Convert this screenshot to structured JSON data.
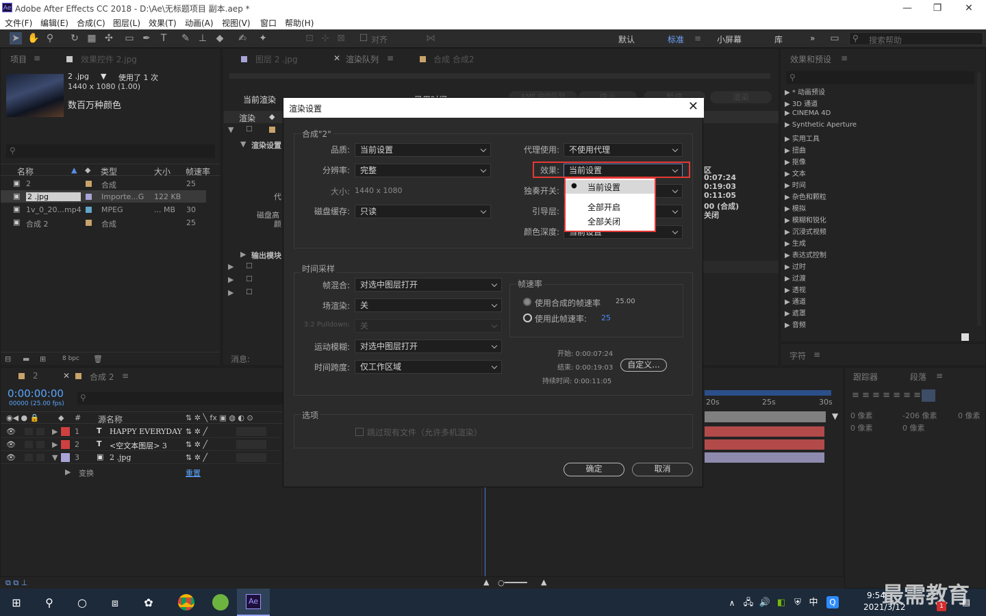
{
  "window": {
    "title": "Adobe After Effects CC 2018 - D:\\Ae\\无标题项目 副本.aep *",
    "logo": "Ae"
  },
  "menu": [
    "文件(F)",
    "编辑(E)",
    "合成(C)",
    "图层(L)",
    "效果(T)",
    "动画(A)",
    "视图(V)",
    "窗口",
    "帮助(H)"
  ],
  "toolbar": {
    "align_label": "对齐",
    "workspaces": [
      "默认",
      "标准",
      "小屏幕",
      "库"
    ],
    "active_workspace": "标准",
    "search_placeholder": "搜索帮助"
  },
  "project_panel": {
    "tab_project": "项目",
    "tab_effect_controls": "效果控件 2.jpg",
    "file_name": "2 .jpg",
    "used": "使用了 1 次",
    "dimensions": "1440 x 1080 (1.00)",
    "colors": "数百万种颜色",
    "columns": [
      "名称",
      "类型",
      "大小",
      "帧速率"
    ],
    "items": [
      {
        "name": "2",
        "type": "合成",
        "size": "",
        "fps": "25",
        "color": "#c8a36a"
      },
      {
        "name": "2 .jpg",
        "type": "Importe...G",
        "size": "122 KB",
        "fps": "",
        "color": "#a9a4d6"
      },
      {
        "name": "1v_0_20...mp4",
        "type": "MPEG",
        "size": "... MB",
        "fps": "30",
        "color": "#62a6c9"
      },
      {
        "name": "合成 2",
        "type": "合成",
        "size": "",
        "fps": "25",
        "color": "#c8a36a"
      }
    ],
    "bpc": "8 bpc"
  },
  "center_tabs": {
    "layer": "图层 2 .jpg",
    "render_queue": "渲染队列",
    "comp": "合成 合成2"
  },
  "render_queue": {
    "current_render": "当前渲染",
    "elapsed": "已用时间",
    "render_col": "渲染",
    "render_settings": "渲染设置",
    "output_module": "输出模块",
    "proxy": "代",
    "disk": "磁盘高",
    "color": "颜",
    "messages": "消息:",
    "right_info": [
      "区",
      "0:07:24",
      "0:19:03",
      "0:11:05",
      "00 (合成)",
      "关闭"
    ],
    "buttons": [
      "AME 中的队列",
      "停止",
      "暂停",
      "渲染"
    ]
  },
  "timeline": {
    "tab_2": "2",
    "tab_comp": "合成 2",
    "timecode": "0:00:00:00",
    "frames": "00000 (25.00 fps)",
    "source_name": "源名称",
    "transform": "变换",
    "reset": "重置",
    "layers": [
      {
        "num": "1",
        "type": "T",
        "name": "HAPPY EVERYDAY",
        "color": "#d04040"
      },
      {
        "num": "2",
        "type": "T",
        "name": "<空文本图层> 3",
        "color": "#d04040"
      },
      {
        "num": "3",
        "type": "img",
        "name": "2 .jpg",
        "color": "#a9a4d6"
      }
    ],
    "ruler": [
      "20s",
      "25s",
      "30s"
    ]
  },
  "effects_panel": {
    "title": "效果和预设",
    "items": [
      "* 动画预设",
      "3D 通道",
      "CINEMA 4D",
      "Synthetic Aperture",
      "实用工具",
      "扭曲",
      "抠像",
      "文本",
      "时间",
      "杂色和颗粒",
      "模拟",
      "模糊和锐化",
      "沉浸式视频",
      "生成",
      "表达式控制",
      "过时",
      "过渡",
      "透视",
      "通道",
      "遮罩",
      "音频"
    ],
    "char_title": "字符"
  },
  "right_lower": {
    "tracker": "跟踪器",
    "paragraph": "段落",
    "px1": "0 像素",
    "px2": "-206 像素",
    "px3": "0 像素",
    "px4": "0 像素",
    "px5": "0 像素"
  },
  "dialog": {
    "title": "渲染设置",
    "comp_group": "合成\"2\"",
    "quality_label": "品质:",
    "quality": "当前设置",
    "resolution_label": "分辨率:",
    "resolution": "完整",
    "size_label": "大小:",
    "size": "1440 x 1080",
    "disk_cache_label": "磁盘缓存:",
    "disk_cache": "只读",
    "proxy_label": "代理使用:",
    "proxy": "不使用代理",
    "effects_label": "效果:",
    "effects": "当前设置",
    "solo_label": "独奏开关:",
    "guide_label": "引导层:",
    "depth_label": "颜色深度:",
    "depth": "当前设置",
    "effects_options": [
      "当前设置",
      "全部开启",
      "全部关闭"
    ],
    "time_group": "时间采样",
    "blend_label": "帧混合:",
    "blend": "对选中图层打开",
    "field_label": "场渲染:",
    "field": "关",
    "pulldown_label": "3:2 Pulldown:",
    "pulldown": "关",
    "motion_label": "运动模糊:",
    "motion": "对选中图层打开",
    "span_label": "时间跨度:",
    "span": "仅工作区域",
    "fps_group": "帧速率",
    "use_comp_fps": "使用合成的帧速率",
    "comp_fps": "25.00",
    "use_this_fps": "使用此帧速率:",
    "this_fps": "25",
    "start": "开始: 0:00:07:24",
    "end": "结束: 0:00:19:03",
    "duration": "持续时间: 0:00:11:05",
    "custom": "自定义...",
    "options_group": "选项",
    "skip_existing": "跳过现有文件（允许多机渲染）",
    "ok": "确定",
    "cancel": "取消"
  },
  "taskbar": {
    "time": "9:54",
    "date": "2021/3/12",
    "ime": "中",
    "watermark": "最需教育",
    "notif": "1"
  }
}
